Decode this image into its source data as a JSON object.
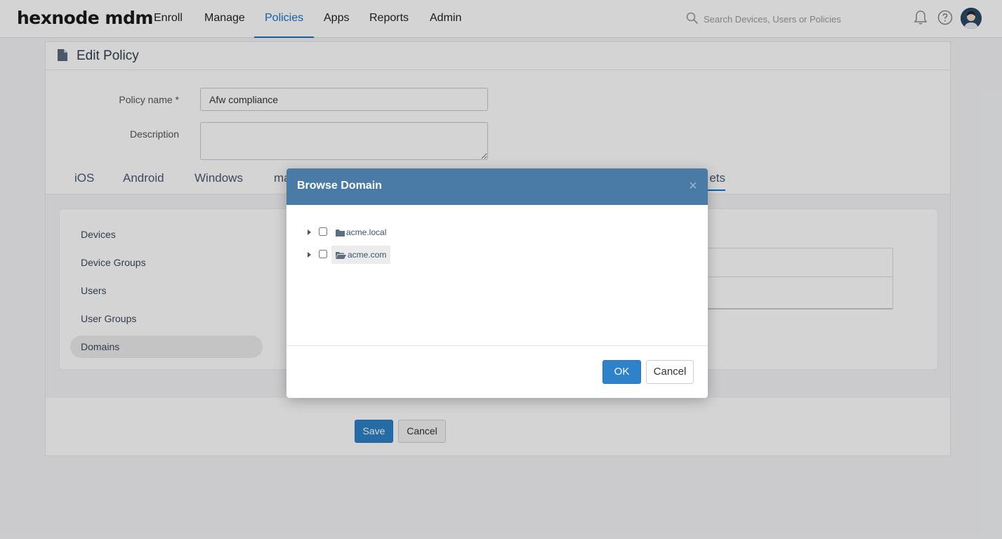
{
  "header": {
    "logo": "hexnode mdm",
    "nav": [
      "Enroll",
      "Manage",
      "Policies",
      "Apps",
      "Reports",
      "Admin"
    ],
    "active_nav": "Policies",
    "search_placeholder": "Search Devices, Users or Policies"
  },
  "page": {
    "title": "Edit Policy",
    "policy_name_label": "Policy name *",
    "policy_name_value": "Afw compliance",
    "description_label": "Description",
    "description_value": "",
    "tabs": [
      "iOS",
      "Android",
      "Windows",
      "ma",
      "ets"
    ],
    "targets": [
      "Devices",
      "Device Groups",
      "Users",
      "User Groups",
      "Domains"
    ],
    "save_label": "Save",
    "cancel_label": "Cancel"
  },
  "modal": {
    "title": "Browse Domain",
    "close_glyph": "×",
    "domains": [
      "acme.local",
      "acme.com"
    ],
    "ok_label": "OK",
    "cancel_label": "Cancel"
  },
  "colors": {
    "accent": "#1a73c6",
    "modal_header": "#4a7ba6",
    "primary_button": "#2d82c9"
  }
}
